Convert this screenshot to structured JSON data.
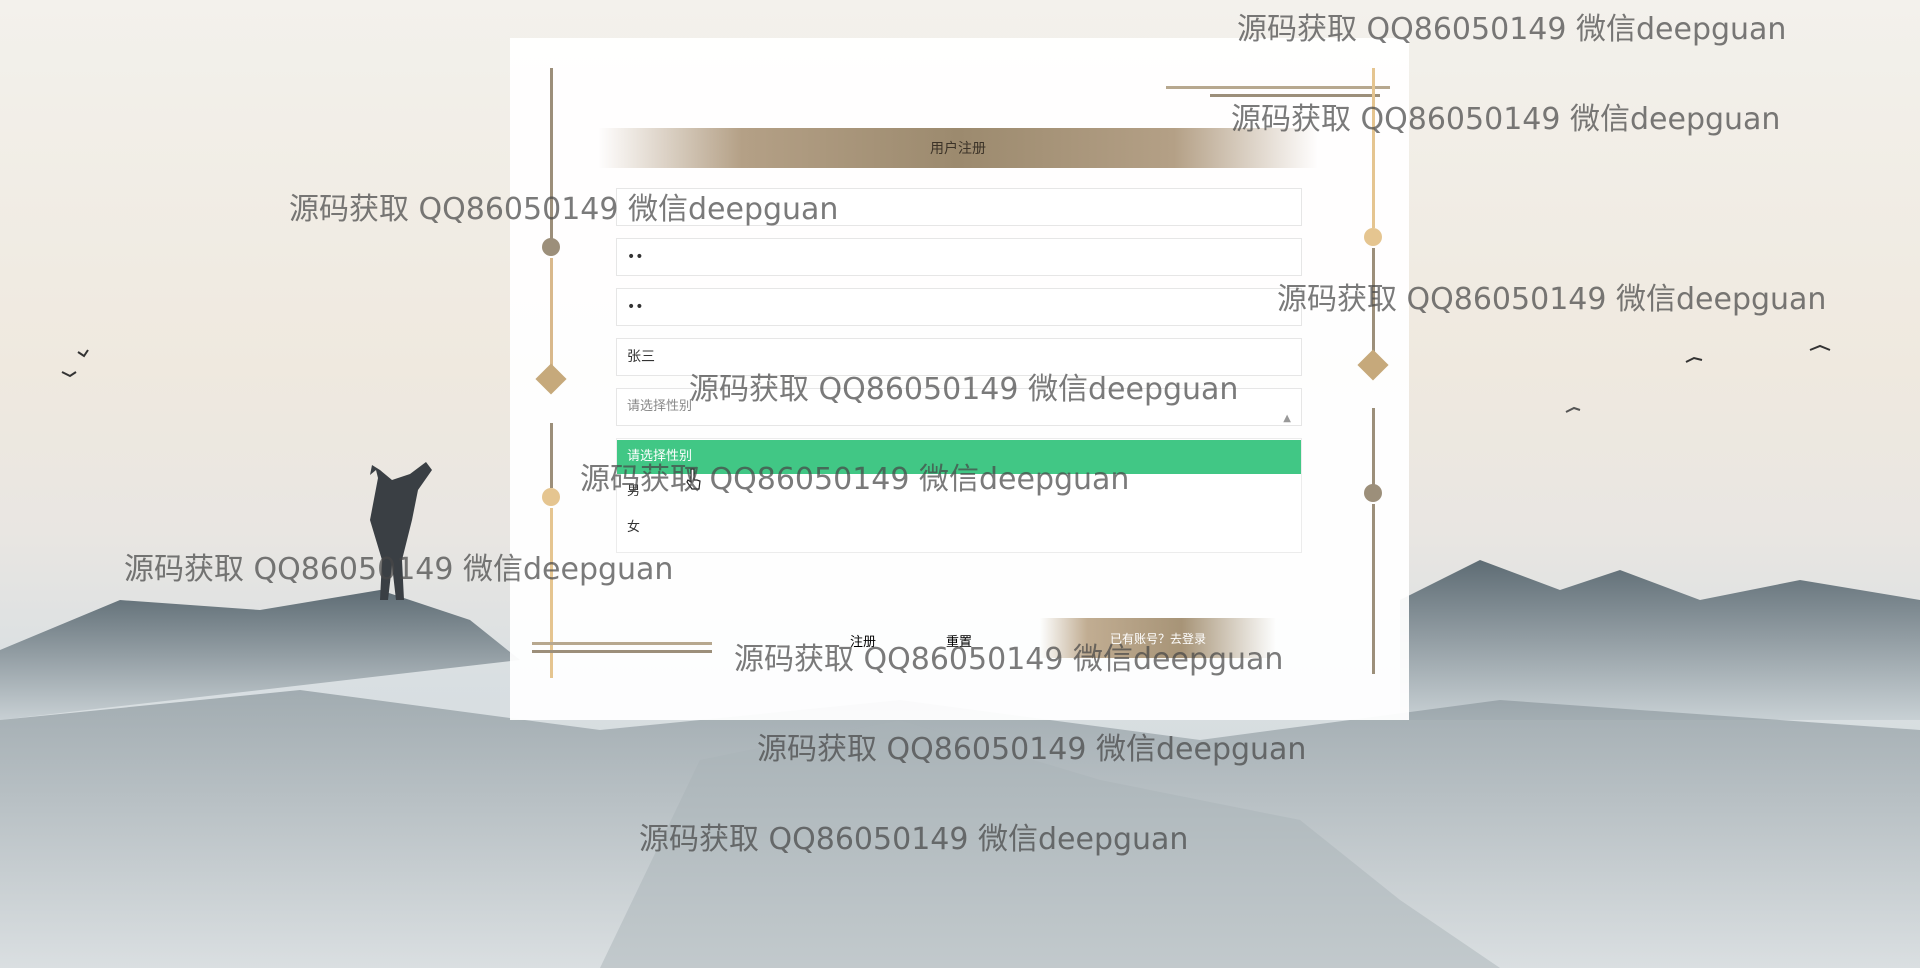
{
  "form": {
    "title": "用户注册",
    "fields": {
      "account_value": "",
      "password_value": "••",
      "confirm_password_value": "••",
      "name_value": "张三",
      "gender_placeholder": "请选择性别"
    },
    "gender_options": [
      "请选择性别",
      "男",
      "女"
    ],
    "selected_index": 0,
    "buttons": {
      "register": "注册",
      "reset": "重置",
      "login_link": "已有账号？去登录"
    }
  },
  "watermark_text": "源码获取 QQ86050149 微信deepguan",
  "colors": {
    "accent_gold": "#c6a97b",
    "selected_option": "#41c785",
    "title_bar": "#9c8a6e"
  },
  "icons": [
    "select-arrow-icon",
    "cursor-icon",
    "diamond-ornament-icon"
  ]
}
